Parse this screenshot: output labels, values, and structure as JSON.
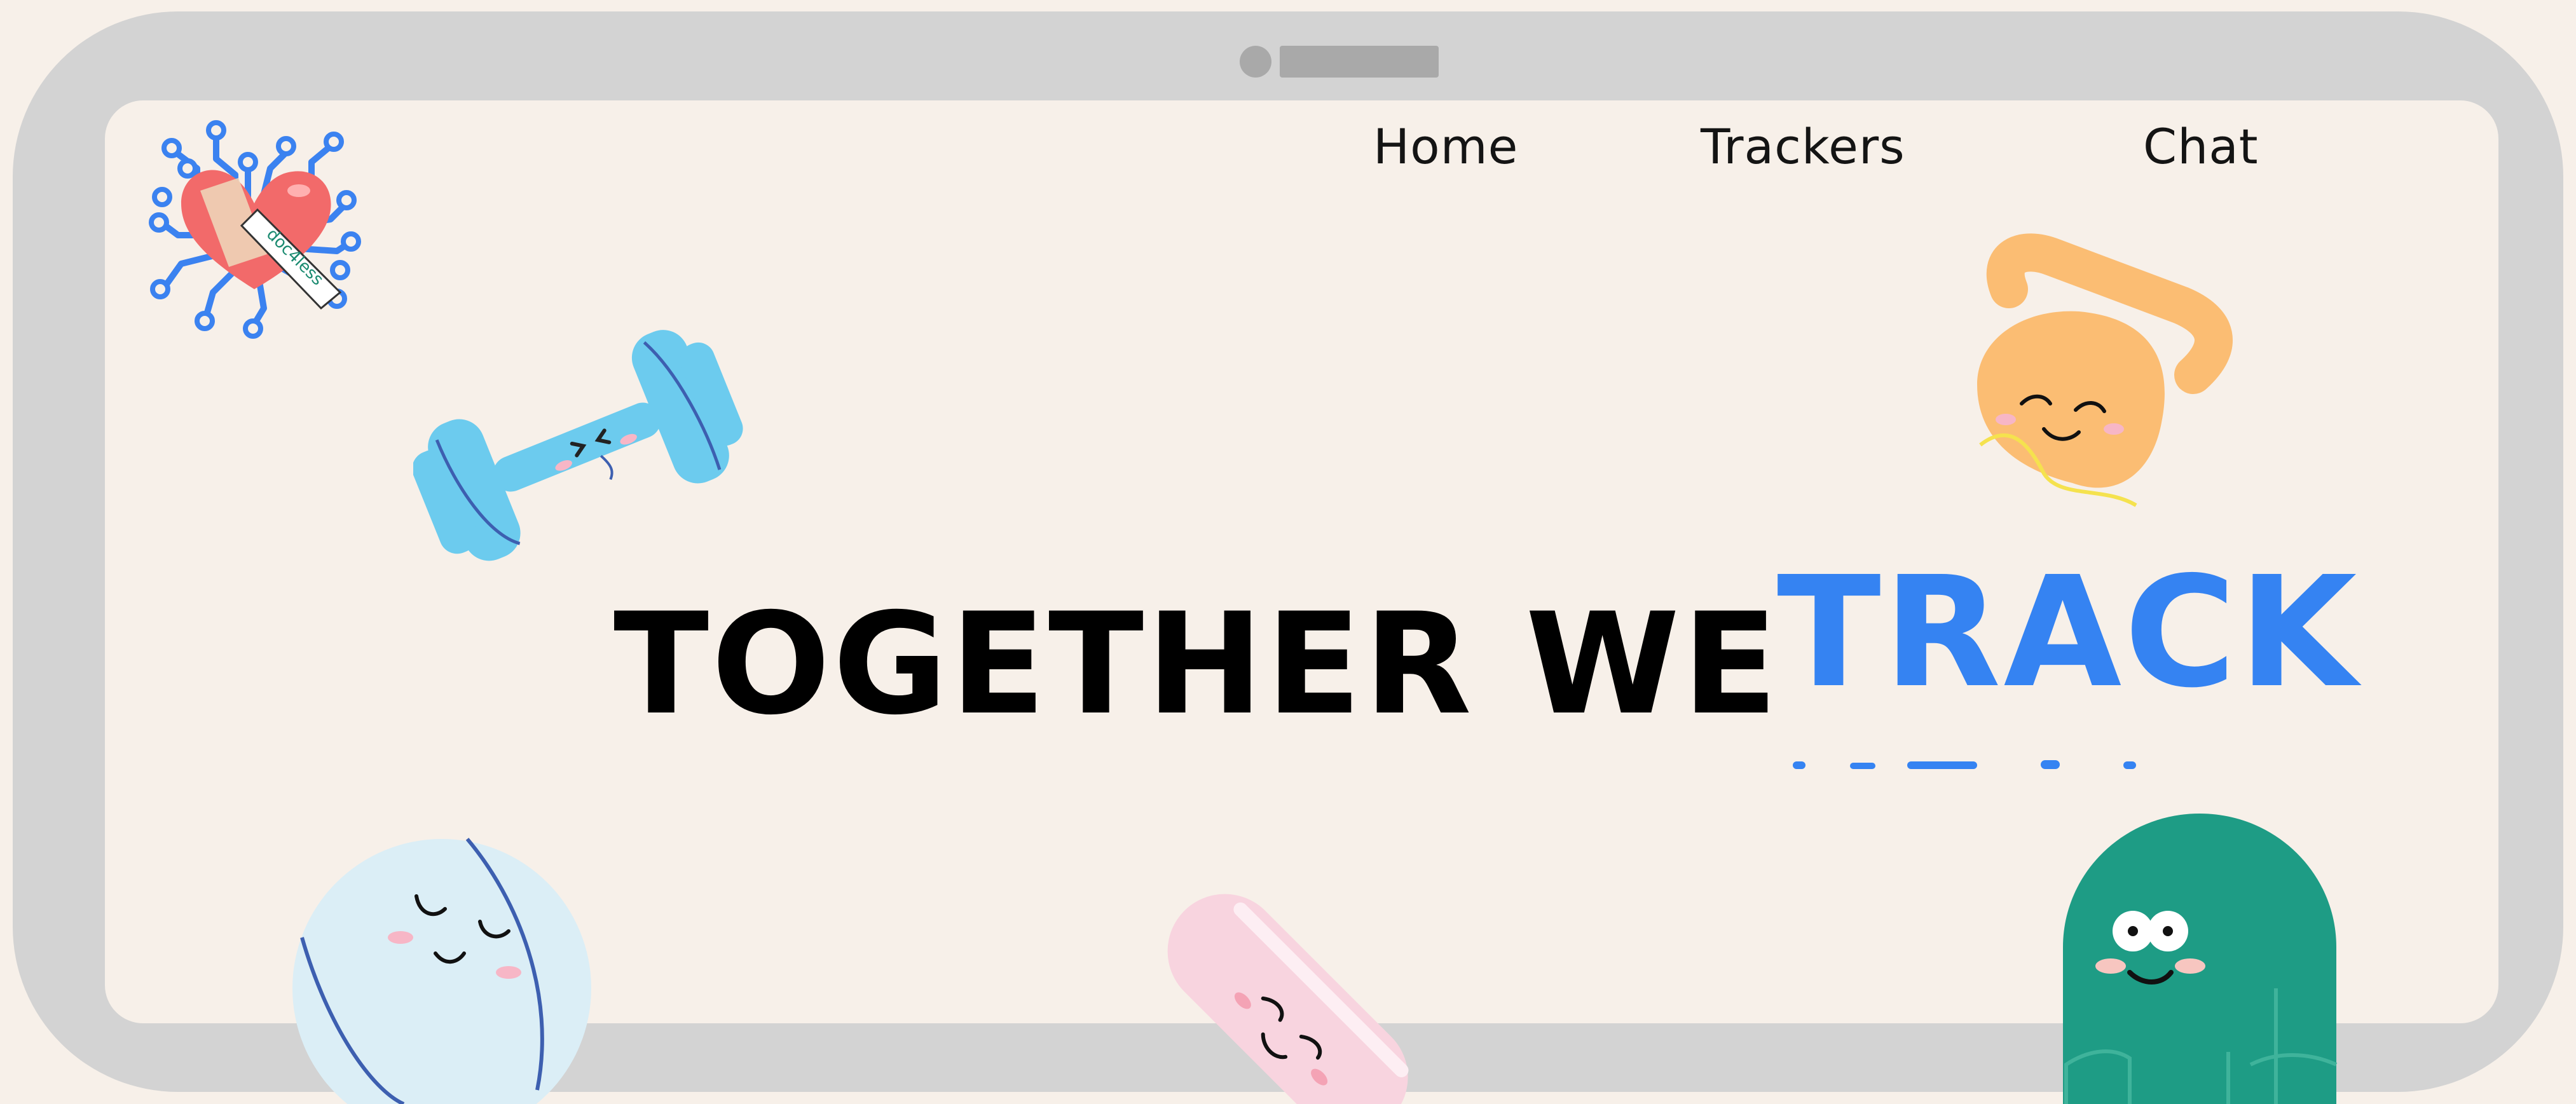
{
  "nav": {
    "home": "Home",
    "trackers": "Trackers",
    "chat": "Chat"
  },
  "logo": {
    "text": "doc4less"
  },
  "hero": {
    "line": "TOGETHER WE",
    "accent": "TRACK"
  },
  "colors": {
    "background": "#f7f0e9",
    "frame": "#d3d3d3",
    "accent": "#3583f2",
    "dumbbell": "#6ccbee",
    "kettlebell": "#fbbd73",
    "ball": "#dbeef6",
    "pill": "#f8d4df",
    "blob": "#1e9c85",
    "heart": "#f26a6a"
  },
  "icons": [
    "circuit-heart-logo",
    "dumbbell-icon",
    "kettlebell-icon",
    "exercise-ball-icon",
    "pill-icon",
    "green-blob-icon"
  ]
}
